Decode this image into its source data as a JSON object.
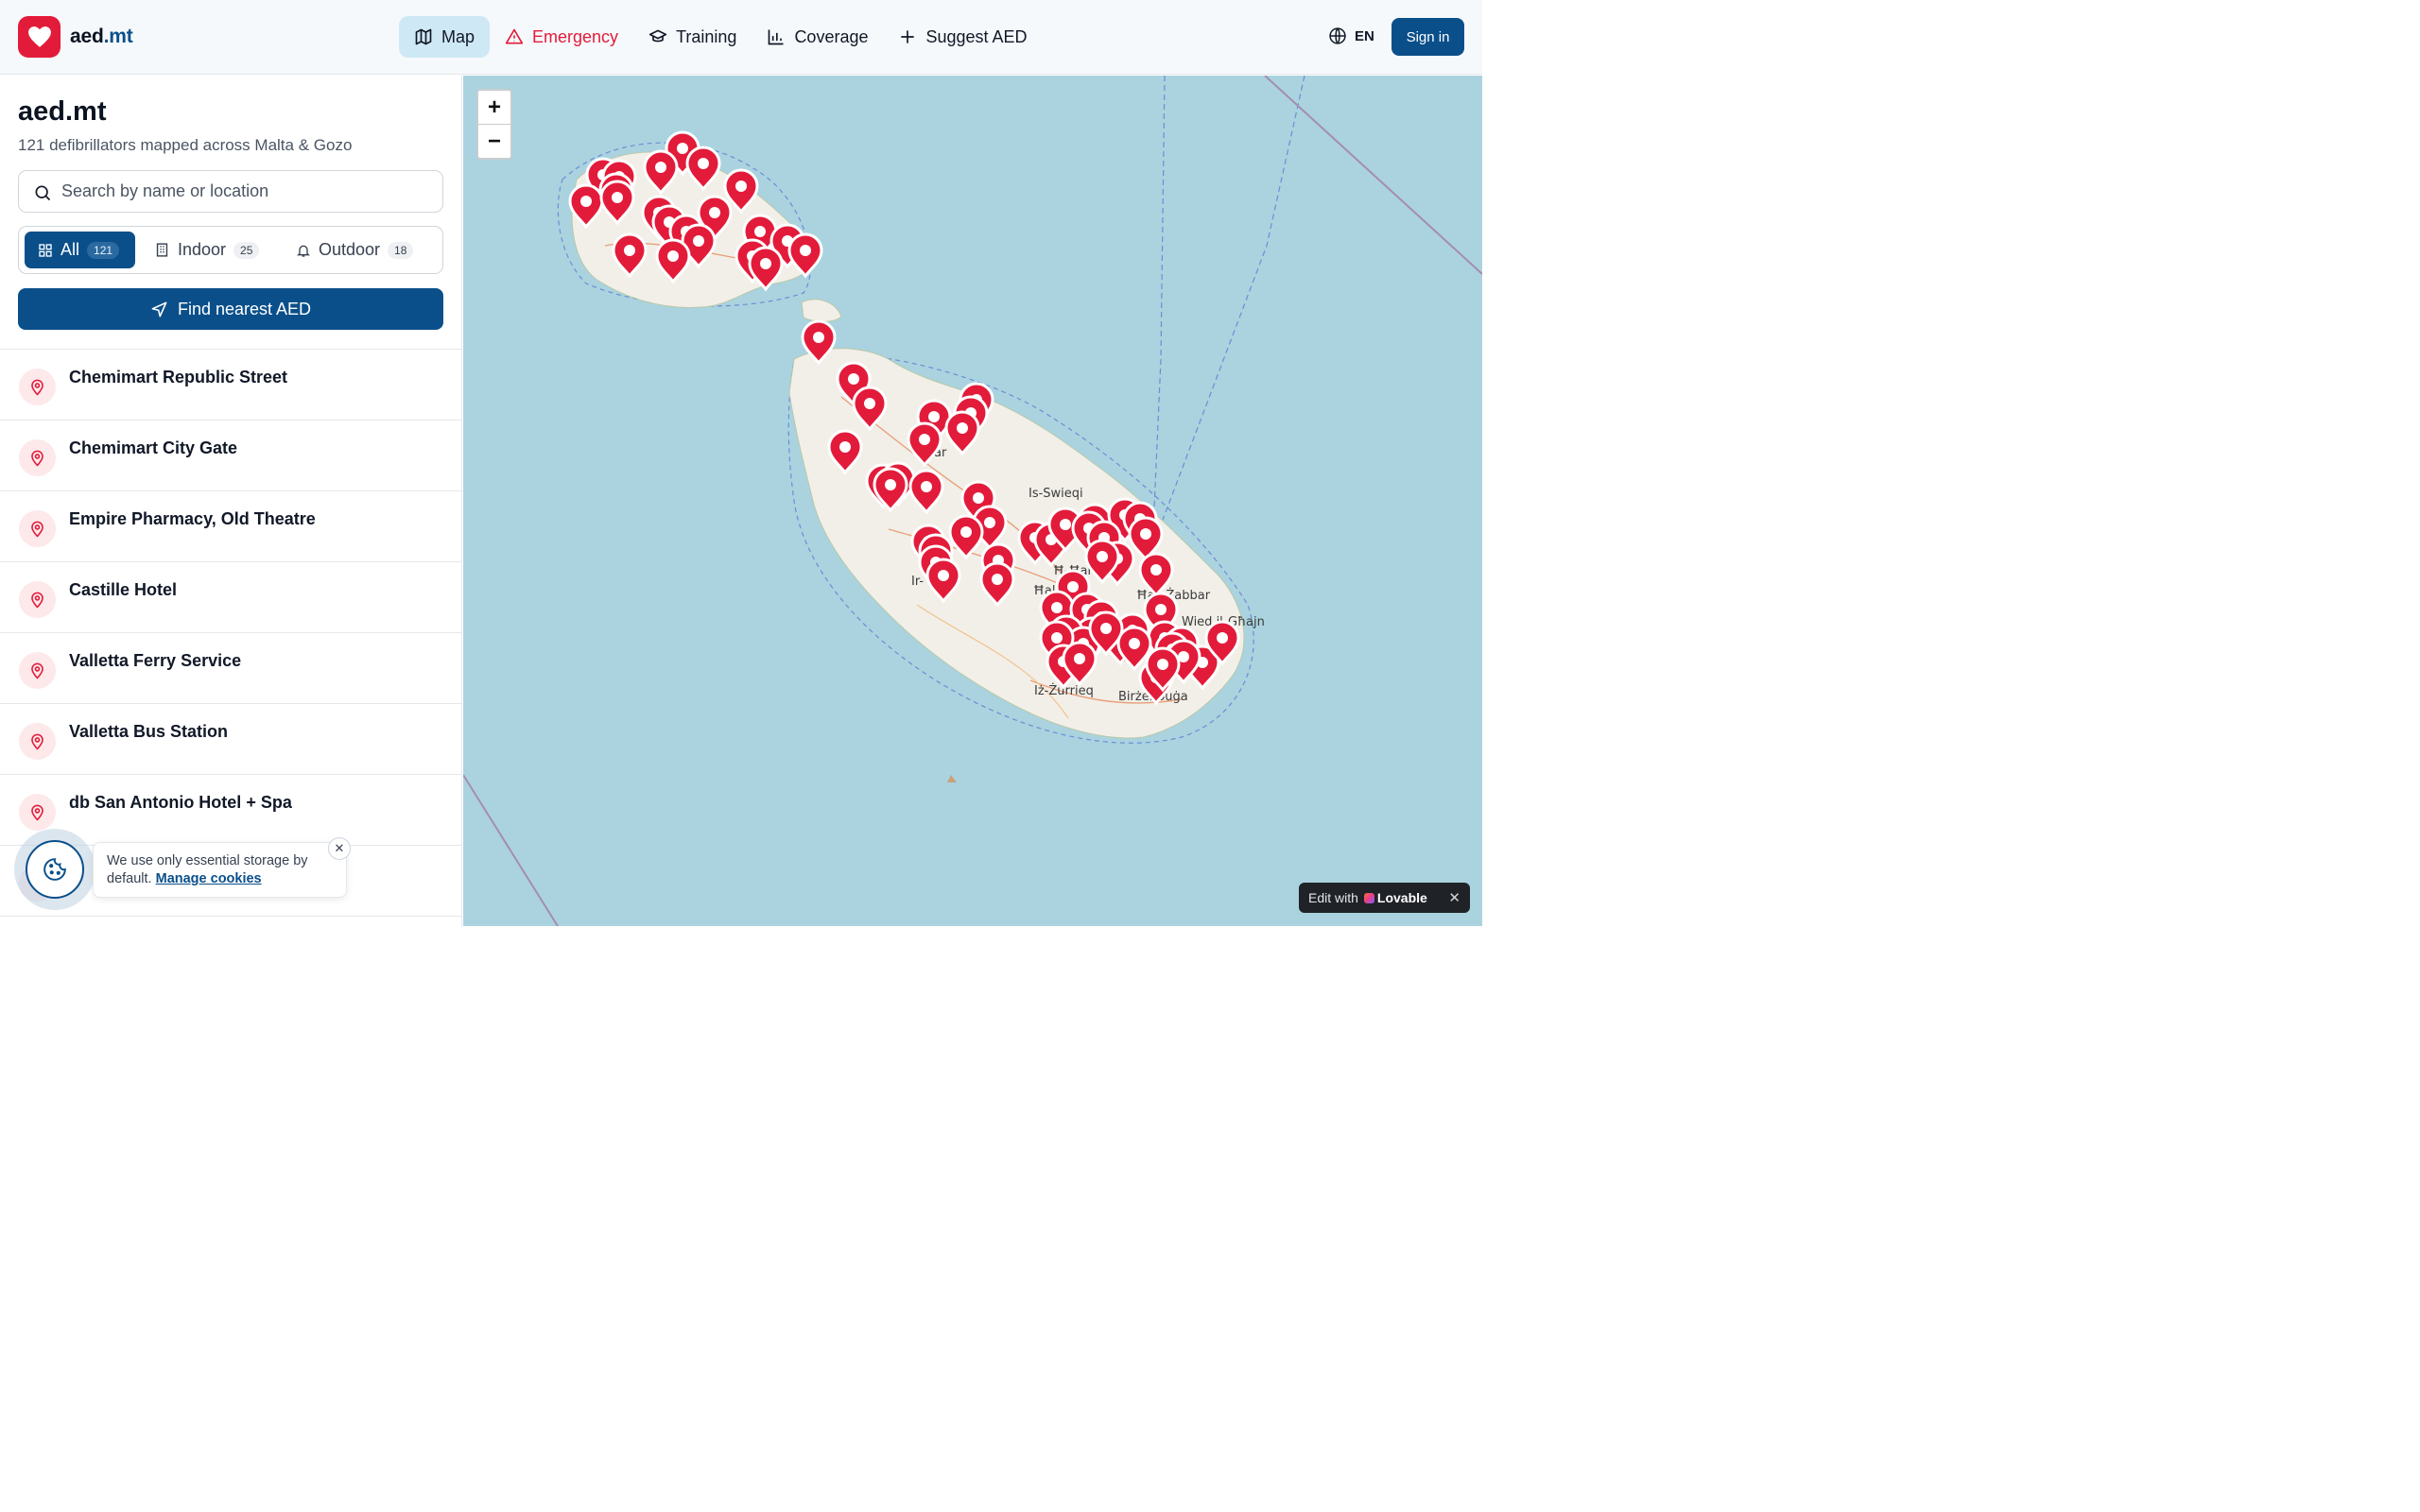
{
  "brand": {
    "name": "aed",
    "tld": ".mt"
  },
  "nav": {
    "items": [
      {
        "label": "Map",
        "icon": "map-icon"
      },
      {
        "label": "Emergency",
        "icon": "warning-triangle-icon"
      },
      {
        "label": "Training",
        "icon": "graduation-cap-icon"
      },
      {
        "label": "Coverage",
        "icon": "bar-chart-icon"
      },
      {
        "label": "Suggest AED",
        "icon": "plus-icon"
      }
    ],
    "language": "EN",
    "signin": "Sign in"
  },
  "sidebar": {
    "title": "aed.mt",
    "subtitle": "121 defibrillators mapped across Malta & Gozo",
    "search_placeholder": "Search by name or location",
    "filters": [
      {
        "label": "All",
        "count": "121"
      },
      {
        "label": "Indoor",
        "count": "25"
      },
      {
        "label": "Outdoor",
        "count": "18"
      }
    ],
    "find_button": "Find nearest AED",
    "locations": [
      "Chemimart Republic Street",
      "Chemimart City Gate",
      "Empire Pharmacy, Old Theatre",
      "Castille Hotel",
      "Valletta Ferry Service",
      "Valletta Bus Station",
      "db San Antonio Hotel + Spa",
      ""
    ]
  },
  "map": {
    "zoom_in": "+",
    "zoom_out": "−",
    "places": [
      "Is-Swieqi",
      "Ħal",
      "Ħaż-Żabbar",
      "Wied il-Għajn",
      "Iż-Żurrieq",
      "Birżebbuġa",
      "Ir-",
      "Ħ-Ħar",
      "S",
      "ar"
    ],
    "colors": {
      "sea": "#aad3df",
      "land": "#f2efe9",
      "marker": "#e31b3a"
    }
  },
  "cookie": {
    "text": "We use only essential storage by default.",
    "link": "Manage cookies"
  },
  "lovable": {
    "prefix": "Edit with",
    "brand": "Lovable"
  }
}
